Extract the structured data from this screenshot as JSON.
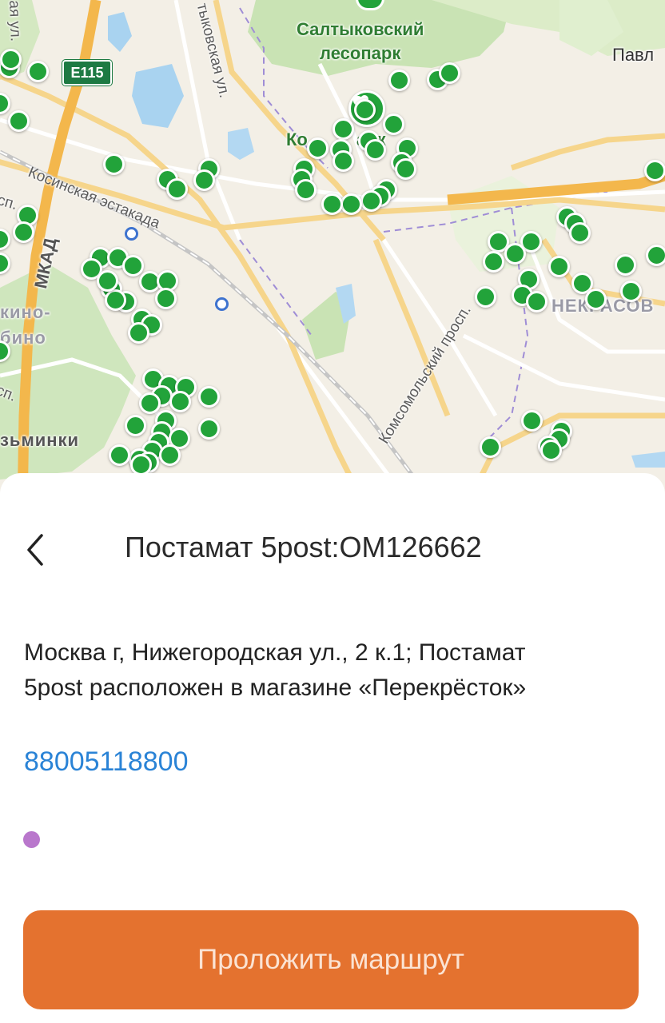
{
  "map": {
    "labels": {
      "saltykovsky_park": "Салтыковский\nлесопарк",
      "kosinsky_park": "Ко          арк",
      "pavl": "Павл",
      "kosinskaya_estakada": "Косинская эстакада",
      "tykovskaya": "тыковская ул.",
      "mkad": "МКАД",
      "kino": "кино-",
      "bino": "бино",
      "zminki": "зьминки",
      "komsomolsky": "Комсомольский просп.",
      "nekrasovka": "НЕКРАСОВ",
      "sp_1": "сп.",
      "sp_2": "сп.",
      "ul_top": "ая ул."
    },
    "route_shield": "E115",
    "pin_color": "#22a33a",
    "pin_count": 118
  },
  "sheet": {
    "back_icon": "chevron-left-icon",
    "title": "Постамат 5post:OM126662",
    "address_line_1": "Москва г,  Нижегородская ул.,  2 к.1; Постамат",
    "address_line_2": "5post расположен в магазине «Перекрёсток»",
    "phone": "88005118800",
    "status_dot_color": "#b977cc",
    "route_button": "Проложить маршрут",
    "accent_color": "#e4722f"
  }
}
